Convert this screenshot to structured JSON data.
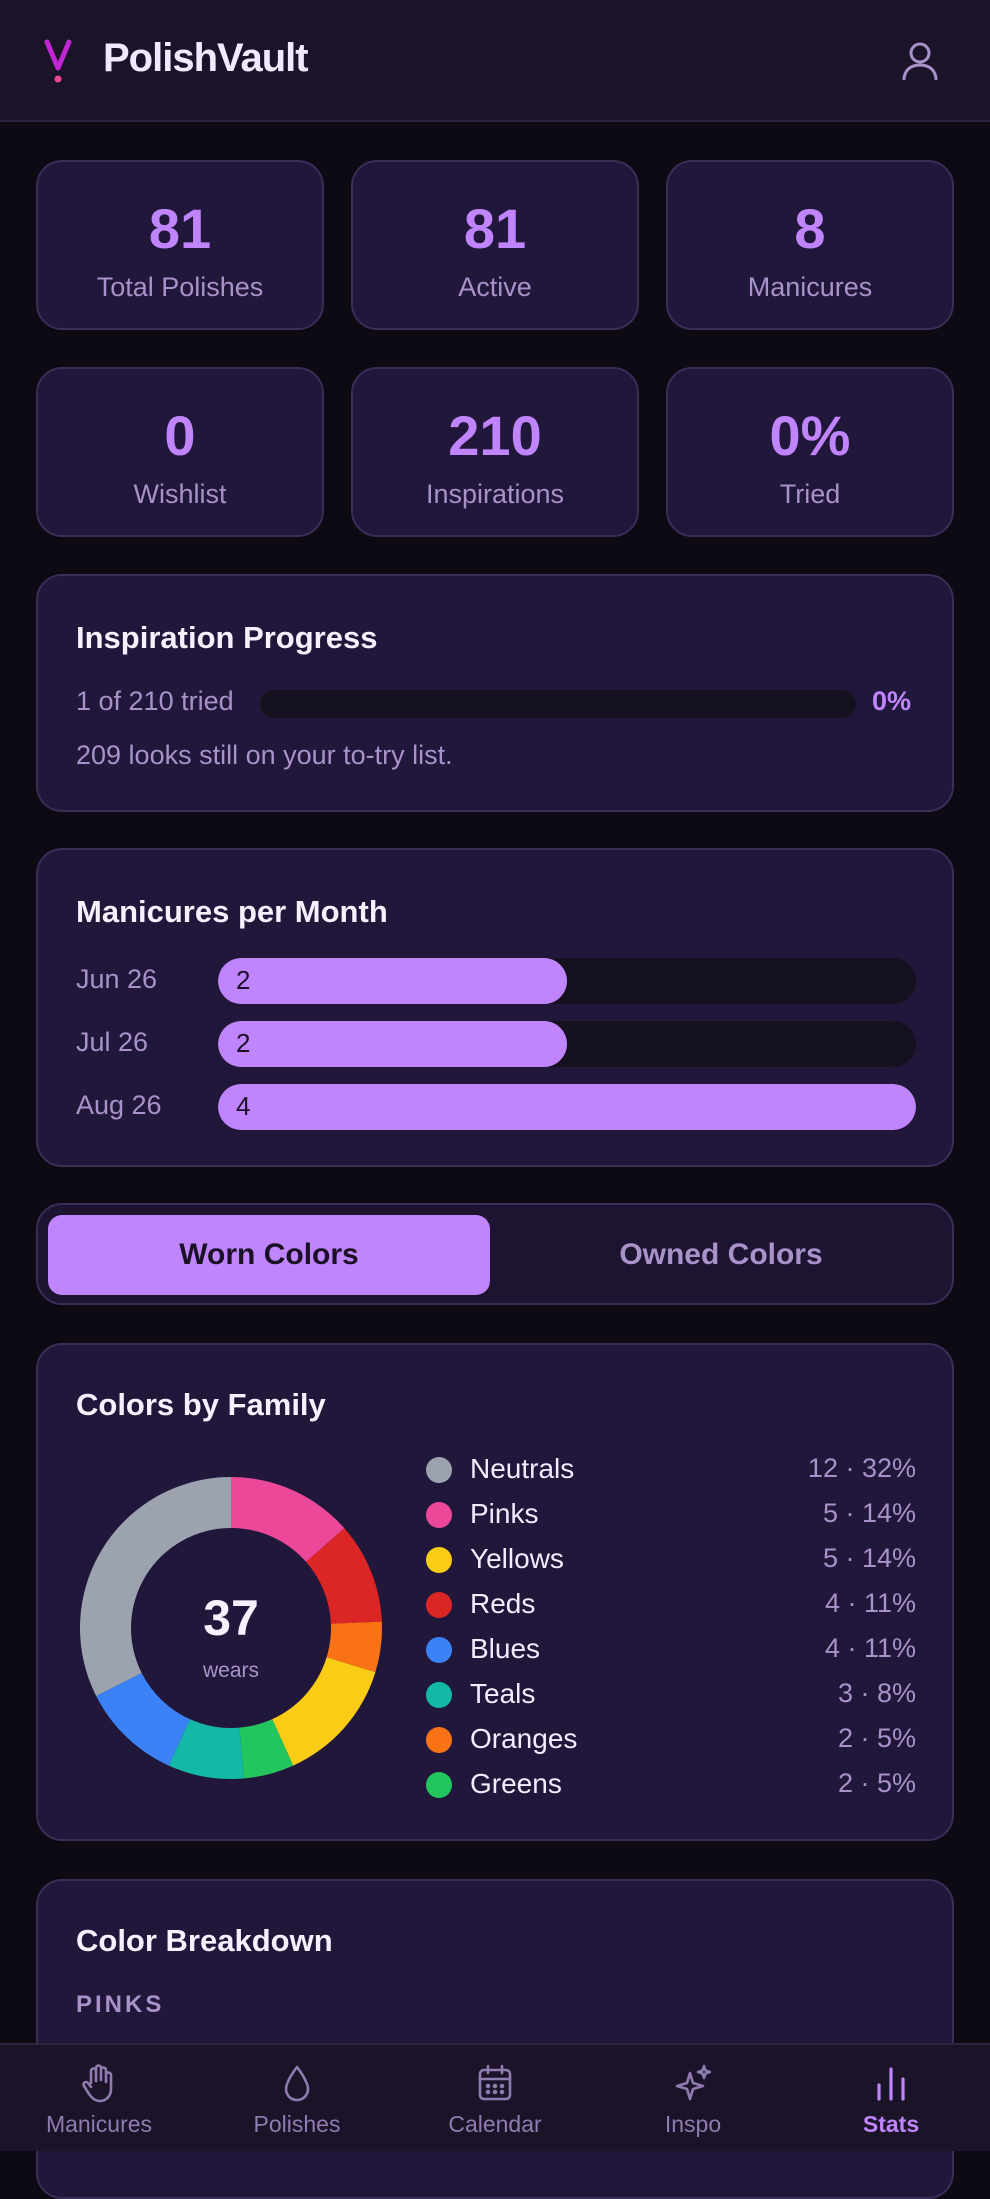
{
  "app": {
    "title": "PolishVault",
    "accent": "#c084fc"
  },
  "stats": [
    {
      "value": "81",
      "label": "Total Polishes"
    },
    {
      "value": "81",
      "label": "Active"
    },
    {
      "value": "8",
      "label": "Manicures"
    },
    {
      "value": "0",
      "label": "Wishlist"
    },
    {
      "value": "210",
      "label": "Inspirations"
    },
    {
      "value": "0%",
      "label": "Tried"
    }
  ],
  "inspiration_progress": {
    "title": "Inspiration Progress",
    "tried_text": "1 of 210 tried",
    "percent_label": "0%",
    "progress_fraction": 0.0,
    "subtitle": "209 looks still on your to-try list."
  },
  "manicures_per_month": {
    "title": "Manicures per Month",
    "rows": [
      {
        "month": "Jun 26",
        "value": "2"
      },
      {
        "month": "Jul 26",
        "value": "2"
      },
      {
        "month": "Aug 26",
        "value": "4"
      }
    ]
  },
  "color_toggle": {
    "worn": "Worn Colors",
    "owned": "Owned Colors"
  },
  "colors_by_family": {
    "title": "Colors by Family",
    "total": "37",
    "total_unit": "wears"
  },
  "color_breakdown": {
    "title": "Color Breakdown",
    "first_group": "PINKS"
  },
  "nav": [
    {
      "label": "Manicures",
      "icon": "hand-icon"
    },
    {
      "label": "Polishes",
      "icon": "drop-icon"
    },
    {
      "label": "Calendar",
      "icon": "calendar-icon"
    },
    {
      "label": "Inspo",
      "icon": "sparkle-icon"
    },
    {
      "label": "Stats",
      "icon": "bar-chart-icon",
      "active": true
    }
  ],
  "chart_data": {
    "type": "pie",
    "title": "Colors by Family",
    "categories": [
      "Neutrals",
      "Pinks",
      "Yellows",
      "Reds",
      "Blues",
      "Teals",
      "Oranges",
      "Greens"
    ],
    "values": [
      12,
      5,
      5,
      4,
      4,
      3,
      2,
      2
    ],
    "labels": [
      "12 · 32%",
      "5 · 14%",
      "5 · 14%",
      "4 · 11%",
      "4 · 11%",
      "3 · 8%",
      "2 · 5%",
      "2 · 5%"
    ],
    "colors": {
      "Neutrals": "#9ca3af",
      "Pinks": "#ec4899",
      "Yellows": "#facc15",
      "Reds": "#dc2626",
      "Blues": "#3b82f6",
      "Teals": "#14b8a6",
      "Oranges": "#f97316",
      "Greens": "#22c55e"
    },
    "ring_order": [
      "Pinks",
      "Reds",
      "Oranges",
      "Yellows",
      "Greens",
      "Teals",
      "Blues",
      "Neutrals"
    ],
    "legend_position": "right"
  }
}
